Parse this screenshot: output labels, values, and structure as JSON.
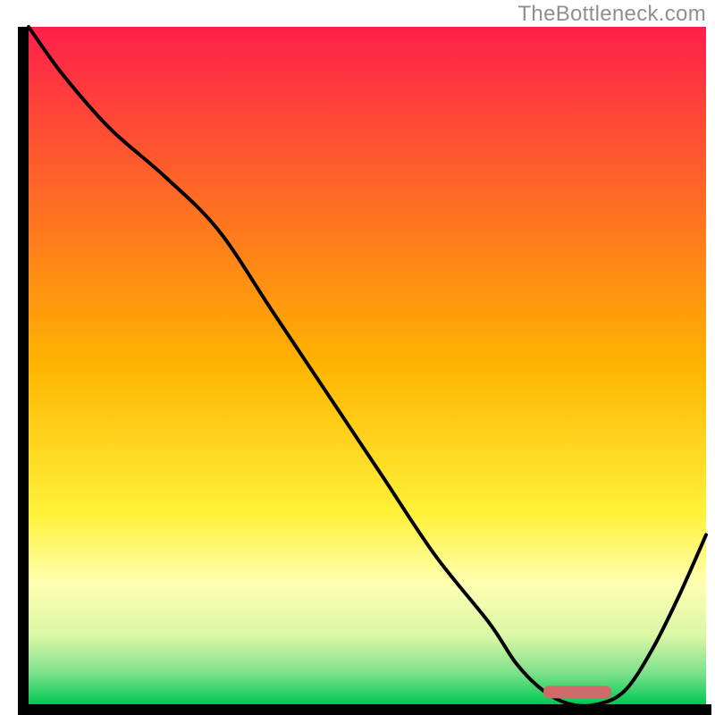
{
  "watermark": "TheBottleneck.com",
  "chart_data": {
    "type": "line",
    "title": "",
    "xlabel": "",
    "ylabel": "",
    "xlim": [
      0,
      100
    ],
    "ylim": [
      0,
      100
    ],
    "axes": {
      "visible": false,
      "ticks": [],
      "grid": false
    },
    "gradient_stops": [
      {
        "offset": 0.0,
        "color": "#ff1f4b"
      },
      {
        "offset": 0.5,
        "color": "#ffb400"
      },
      {
        "offset": 0.72,
        "color": "#fff23a"
      },
      {
        "offset": 0.82,
        "color": "#ffffb0"
      },
      {
        "offset": 0.9,
        "color": "#d9f7a6"
      },
      {
        "offset": 0.955,
        "color": "#7be08a"
      },
      {
        "offset": 1.0,
        "color": "#00c853"
      }
    ],
    "series": [
      {
        "name": "bottleneck-curve",
        "x": [
          0,
          5,
          12,
          20,
          28,
          36,
          44,
          52,
          60,
          68,
          72,
          76,
          80,
          84,
          88,
          92,
          96,
          100
        ],
        "y": [
          100,
          93,
          85,
          78,
          70,
          58,
          46,
          34,
          22,
          12,
          6,
          2,
          0,
          0,
          2,
          8,
          16,
          25
        ]
      }
    ],
    "marker": {
      "name": "optimal-range",
      "x_start": 76,
      "x_end": 86,
      "y": 1.8,
      "color": "#d06a6a"
    },
    "frame": {
      "stroke": "#000000",
      "stroke_width": 12
    }
  }
}
